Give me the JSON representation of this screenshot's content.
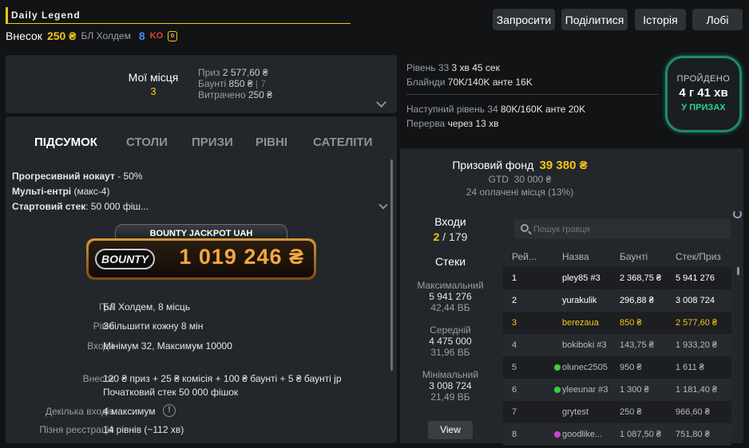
{
  "header": {
    "title": "Daily Legend",
    "buyin_label": "Внесок",
    "buyin_value": "250 ₴",
    "game": "БЛ Холдем",
    "count": "8",
    "ko_badge": "KO",
    "colors": {
      "accent": "#f5c518",
      "ko": "#e04040",
      "count": "#4a8cff"
    }
  },
  "buttons": {
    "invite": "Запросити",
    "share": "Поділитися",
    "history": "Історія",
    "lobby": "Лобі"
  },
  "my_places": {
    "label": "Мої місця",
    "value": "3",
    "prize_label": "Приз",
    "prize_value": "2 577,60 ₴",
    "bounty_label": "Баунті",
    "bounty_value": "850 ₴",
    "bounty_count": "| 7",
    "spent_label": "Витрачено",
    "spent_value": "250 ₴"
  },
  "level": {
    "line1_label": "Рівень 33",
    "line1_value": "3 хв 45 сек",
    "line2_label": "Блайнди",
    "line2_value": "70K/140K анте 16K",
    "line3_label": "Наступний рівень 34",
    "line3_value": "80K/160K анте 20K",
    "line4_label": "Перерва",
    "line4_value": "через 13 хв"
  },
  "status_badge": {
    "label": "ПРОЙДЕНО",
    "time": "4 г 41 хв",
    "sub": "У ПРИЗАХ"
  },
  "tabs": [
    "ПІДСУМОК",
    "СТОЛИ",
    "ПРИЗИ",
    "РІВНІ",
    "САТЕЛІТИ"
  ],
  "summary": {
    "line1_bold": "Прогресивний нокаут",
    "line1_rest": " - 50%",
    "line2_bold": "Мульті-ентрі",
    "line2_rest": " (макс-4)",
    "line3_bold": "Стартовий стек",
    "line3_rest": ": 50 000 фіш..."
  },
  "jackpot": {
    "title": "BOUNTY JACKPOT UAH",
    "logo": "BOUNTY",
    "amount": "1 019 246 ₴"
  },
  "details": {
    "game_label": "Гра",
    "game_value": "БЛ Холдем, 8 місць",
    "levels_label": "Рівні",
    "levels_value": "Збільшити кожну 8 мін",
    "entries_label": "Входи",
    "entries_value": "Мінімум 32, Максимум 10000",
    "buyin_label": "Внесок",
    "buyin_value1": "120 ₴ приз + 25 ₴ комісія + 100 ₴ баунті + 5 ₴ баунті jp",
    "buyin_value2": "Початковий стек 50 000 фішок",
    "multi_label": "Декілька входів",
    "multi_value": "4 максимум",
    "late_label": "Пізня реєстрація",
    "late_value": "14 рівнів (~112 хв)"
  },
  "prize_pool": {
    "label": "Призовий фонд",
    "value": "39 380 ₴",
    "gtd": "GTD  30 000 ₴",
    "paid": "24 оплачені місця (13%)"
  },
  "entries": {
    "label": "Входи",
    "current": "2",
    "total": "/ 179"
  },
  "stacks": {
    "label": "Стеки",
    "max_label": "Максимальний",
    "max_value": "5 941 276",
    "max_bb": "42,44 ВБ",
    "avg_label": "Середній",
    "avg_value": "4 475 000",
    "avg_bb": "31,96 ВБ",
    "min_label": "Мінімальний",
    "min_value": "3 008 724",
    "min_bb": "21,49 ВБ",
    "view_button": "View"
  },
  "search": {
    "placeholder": "Пошук гравця"
  },
  "players_table": {
    "columns": [
      "Рей...",
      "Назва",
      "Баунті",
      "Стек/Приз"
    ],
    "rows": [
      {
        "rank": "1",
        "name": "pley85 #3",
        "bounty": "2 368,75 ₴",
        "stack": "5 941 276",
        "dot": "",
        "highlight": false,
        "dim": false
      },
      {
        "rank": "2",
        "name": "yurakulik",
        "bounty": "296,88 ₴",
        "stack": "3 008 724",
        "dot": "",
        "highlight": false,
        "dim": false
      },
      {
        "rank": "3",
        "name": "berezaua",
        "bounty": "850 ₴",
        "stack": "2 577,60 ₴",
        "dot": "",
        "highlight": true,
        "dim": false
      },
      {
        "rank": "4",
        "name": "bokiboki #3",
        "bounty": "143,75 ₴",
        "stack": "1 933,20 ₴",
        "dot": "",
        "highlight": false,
        "dim": true
      },
      {
        "rank": "5",
        "name": "olunec2505",
        "bounty": "950 ₴",
        "stack": "1 611 ₴",
        "dot": "#3ccf3c",
        "highlight": false,
        "dim": true
      },
      {
        "rank": "6",
        "name": "yleeunar #3",
        "bounty": "1 300 ₴",
        "stack": "1 181,40 ₴",
        "dot": "#3ccf3c",
        "highlight": false,
        "dim": true
      },
      {
        "rank": "7",
        "name": "grytest",
        "bounty": "250 ₴",
        "stack": "966,60 ₴",
        "dot": "",
        "highlight": false,
        "dim": true
      },
      {
        "rank": "8",
        "name": "goodlike...",
        "bounty": "1 087,50 ₴",
        "stack": "751,80 ₴",
        "dot": "#d63cd6",
        "highlight": false,
        "dim": true
      }
    ]
  }
}
